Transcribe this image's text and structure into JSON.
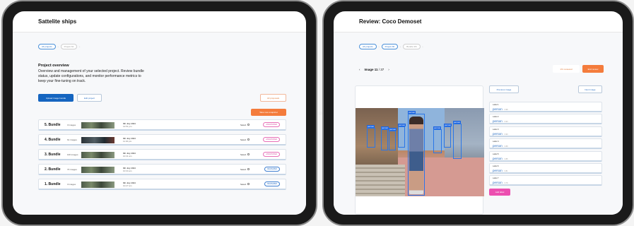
{
  "left": {
    "title": "Sattelite ships",
    "breadcrumb": [
      "All projects",
      "Project 64"
    ],
    "overview_title": "Project overview",
    "overview_text": "Overview and management of your selected project. Review bundle status, update configurations, and monitor performance metrics to keep your fine-tuning on track.",
    "upload_label": "Upload image bundle",
    "edit_label": "Edit project",
    "all_proposals_label": "All proposals",
    "snapshot_label": "Take new snapshot",
    "select_label": "Select",
    "bundles": [
      {
        "name": "5. Bundle",
        "images": "3 images",
        "date": "9th July 2024",
        "time": "12:51 pm",
        "status": "ANNOTATED",
        "kind": "ann",
        "dark": false
      },
      {
        "name": "4. Bundle",
        "images": "61 images",
        "date": "9th July 2024",
        "time": "11:30 pm",
        "status": "ANNOTATED",
        "kind": "ann",
        "dark": true
      },
      {
        "name": "3. Bundle",
        "images": "100 images",
        "date": "9th July 2024",
        "time": "10:41 am",
        "status": "ANNOTATED",
        "kind": "ann",
        "dark": false
      },
      {
        "name": "2. Bundle",
        "images": "70 images",
        "date": "9th July 2024",
        "time": "10:34 am",
        "status": "REVIEWED",
        "kind": "rev",
        "dark": false
      },
      {
        "name": "1. Bundle",
        "images": "3 images",
        "date": "9th July 2024",
        "time": "10:27 am",
        "status": "REVIEWED",
        "kind": "rev",
        "dark": false
      }
    ]
  },
  "right": {
    "title": "Review: Coco Demoset",
    "breadcrumb": [
      "All projects",
      "Project 66",
      "Bundle 3/6"
    ],
    "image_label": "Image 11",
    "image_total": "/ 37",
    "reviewed_label": "1% reviewed",
    "end_review_label": "End review",
    "prev_label": "Previous image",
    "next_label": "Next image",
    "add_label": "Add label",
    "box_label": "person",
    "labels": [
      {
        "level": "Label 1",
        "name": "person",
        "score": "0.98"
      },
      {
        "level": "Label 2",
        "name": "person",
        "score": "0.93"
      },
      {
        "level": "Label 3",
        "name": "person",
        "score": "0.90"
      },
      {
        "level": "Label 4",
        "name": "person",
        "score": "0.88"
      },
      {
        "level": "Label 5",
        "name": "person",
        "score": "0.85"
      },
      {
        "level": "Label 6",
        "name": "person",
        "score": "0.81"
      },
      {
        "level": "Label 7",
        "name": "person",
        "score": "0.78"
      }
    ]
  },
  "colors": {
    "primary": "#1565c0",
    "accent": "#f47c3c",
    "annotated": "#d2479a",
    "reviewed": "#2a6fc4",
    "add_label": "#ec4fb0"
  }
}
